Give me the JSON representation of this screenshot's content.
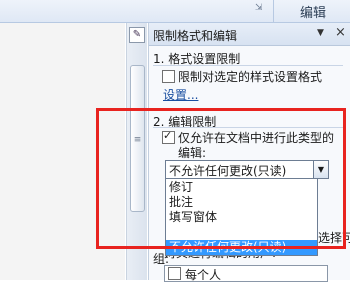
{
  "ribbon": {
    "group_label": "编辑",
    "launcher_glyph": "⇲"
  },
  "scrollbar": {
    "grip_glyph": "≡"
  },
  "pane": {
    "title": "限制格式和编辑",
    "dropdown_glyph": "▼",
    "close_glyph": "×",
    "section1": {
      "heading": "1. 格式设置限制",
      "checkbox_label": "限制对选定的样式设置格式",
      "checked": false,
      "settings_link": "设置..."
    },
    "section2": {
      "heading": "2. 编辑限制",
      "checkbox_label_line1": "仅允许在文档中进行此类型的",
      "checkbox_label_line2": "编辑:",
      "checked": true,
      "select_value": "不允许任何更改(只读)",
      "select_options": [
        "修订",
        "批注",
        "填写窗体",
        "不允许任何更改(只读)"
      ],
      "selected_index": 3,
      "behind_text_1": "对其进行编辑的用户:",
      "behind_text_2": "组:",
      "behind_text_3": "选择可",
      "everyone_label": "每个人",
      "everyone_checked": false
    }
  },
  "colors": {
    "highlight": "#e8231f",
    "selection": "#3399ff"
  }
}
